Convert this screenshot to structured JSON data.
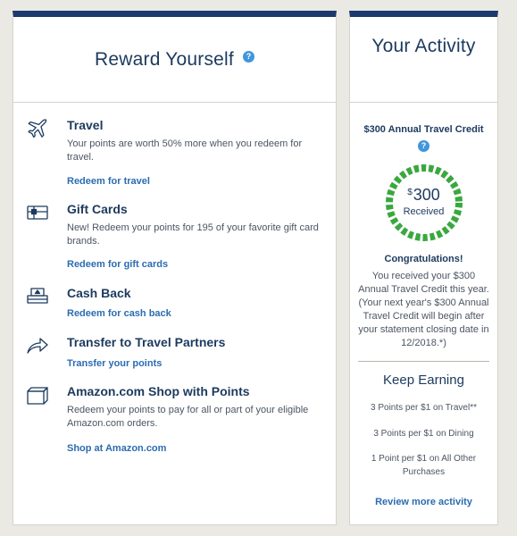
{
  "colors": {
    "page_bg": "#ebe9e3",
    "card_border_top": "#1c3a6e",
    "heading_navy": "#1c3a5e",
    "link_blue": "#2b6cb0",
    "help_blue": "#4196dc",
    "badge_green": "#3aa83f"
  },
  "reward_panel": {
    "title": "Reward Yourself",
    "help_label": "?",
    "options": [
      {
        "icon": "airplane-icon",
        "title": "Travel",
        "description": "Your points are worth 50% more when you redeem for travel.",
        "link": "Redeem for travel"
      },
      {
        "icon": "gift-card-icon",
        "title": "Gift Cards",
        "description": "New! Redeem your points for 195 of your favorite gift card brands.",
        "link": "Redeem for gift cards"
      },
      {
        "icon": "cash-icon",
        "title": "Cash Back",
        "description": "",
        "link": "Redeem for cash back"
      },
      {
        "icon": "transfer-arrow-icon",
        "title": "Transfer to Travel Partners",
        "description": "",
        "link": "Transfer your points"
      },
      {
        "icon": "box-icon",
        "title": "Amazon.com Shop with Points",
        "description": "Redeem your points to pay for all or part of your eligible Amazon.com orders.",
        "link": "Shop at Amazon.com"
      }
    ]
  },
  "activity_panel": {
    "title": "Your Activity",
    "credit_title": "$300 Annual Travel Credit",
    "help_label": "?",
    "badge": {
      "currency": "$",
      "amount": "300",
      "label": "Received",
      "progress": 1.0
    },
    "congrats_title": "Congratulations!",
    "congrats_body": "You received your $300 Annual Travel Credit this year. (Your next year's $300 Annual Travel Credit will begin after your statement closing date in 12/2018.*)",
    "keep_earning_title": "Keep Earning",
    "earn_items": [
      "3 Points per $1 on Travel**",
      "3 Points per $1 on Dining",
      "1 Point per $1 on All Other Purchases"
    ],
    "review_link": "Review more activity"
  }
}
